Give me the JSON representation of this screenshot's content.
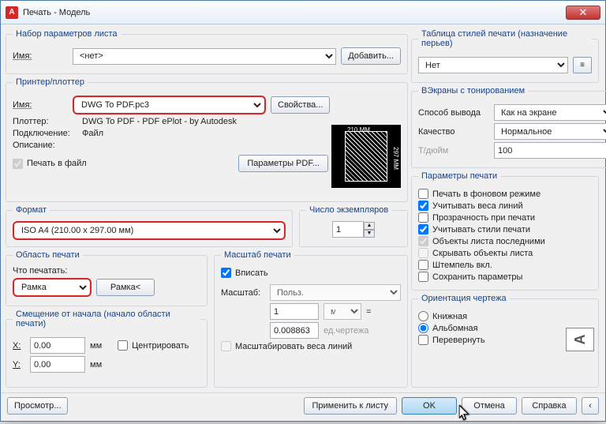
{
  "title": "Печать - Модель",
  "page_setup": {
    "legend": "Набор параметров листа",
    "name_label": "Имя:",
    "name_value": "<нет>",
    "add_btn": "Добавить..."
  },
  "printer": {
    "legend": "Принтер/плоттер",
    "name_label": "Имя:",
    "name_value": "DWG To PDF.pc3",
    "props_btn": "Свойства...",
    "plotter_label": "Плоттер:",
    "plotter_value": "DWG To PDF - PDF ePlot - by Autodesk",
    "conn_label": "Подключение:",
    "conn_value": "Файл",
    "desc_label": "Описание:",
    "to_file": "Печать в файл",
    "pdf_params": "Параметры PDF...",
    "prev_w": "210 MM",
    "prev_h": "297 MM"
  },
  "paper": {
    "legend": "Формат",
    "value": "ISO A4 (210.00 x 297.00 мм)"
  },
  "copies": {
    "legend": "Число экземпляров",
    "value": "1"
  },
  "area": {
    "legend": "Область печати",
    "what_label": "Что печатать:",
    "value": "Рамка",
    "frame_btn": "Рамка<"
  },
  "scale": {
    "legend": "Масштаб печати",
    "fit": "Вписать",
    "scale_label": "Масштаб:",
    "scale_value": "Польз.",
    "mm": "мм",
    "mm_val": "1",
    "units_val": "0.008863",
    "units_label": "ед.чертежа",
    "weights": "Масштабировать веса линий"
  },
  "offset": {
    "legend": "Смещение от начала (начало области печати)",
    "x": "X:",
    "y": "Y:",
    "xv": "0.00",
    "yv": "0.00",
    "mm": "мм",
    "center": "Центрировать"
  },
  "styles": {
    "legend": "Таблица стилей печати (назначение перьев)",
    "value": "Нет"
  },
  "shaded": {
    "legend": "ВЭкраны с тонированием",
    "mode_label": "Способ вывода",
    "mode_value": "Как на экране",
    "quality_label": "Качество",
    "quality_value": "Нормальное",
    "dpi_label": "Т/дюйм",
    "dpi_value": "100"
  },
  "options": {
    "legend": "Параметры печати",
    "bg": "Печать в фоновом режиме",
    "lw": "Учитывать веса линий",
    "tr": "Прозрачность при печати",
    "ps": "Учитывать стили печати",
    "last": "Объекты листа последними",
    "hide": "Скрывать объекты листа",
    "stamp": "Штемпель вкл.",
    "save": "Сохранить параметры"
  },
  "orient": {
    "legend": "Ориентация чертежа",
    "portrait": "Книжная",
    "landscape": "Альбомная",
    "upside": "Перевернуть"
  },
  "footer": {
    "preview": "Просмотр...",
    "apply": "Применить к листу",
    "ok": "OK",
    "cancel": "Отмена",
    "help": "Справка"
  }
}
